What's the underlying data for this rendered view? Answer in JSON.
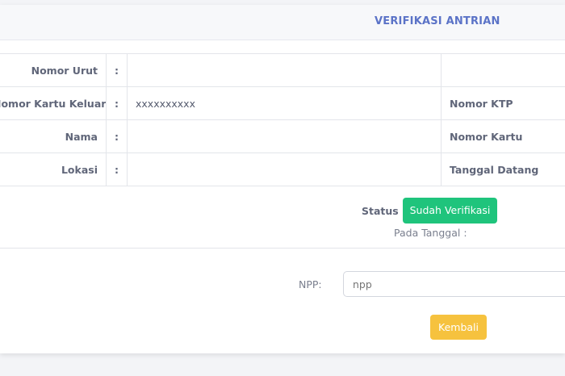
{
  "header": {
    "title": "VERIFIKASI ANTRIAN"
  },
  "info": {
    "rows": [
      {
        "label": "Nomor Urut",
        "colon": ":",
        "value": "",
        "label2": ""
      },
      {
        "label": "Nomor Kartu Keluarga",
        "colon": ":",
        "value": "xxxxxxxxxx",
        "label2": "Nomor KTP"
      },
      {
        "label": "Nama",
        "colon": ":",
        "value": "",
        "label2": "Nomor Kartu"
      },
      {
        "label": "Lokasi",
        "colon": ":",
        "value": "",
        "label2": "Tanggal Datang"
      }
    ]
  },
  "status": {
    "label": "Status :",
    "badge": "Sudah Verifikasi",
    "badge_color": "#1fc47c",
    "date_label": "Pada Tanggal :"
  },
  "form": {
    "npp_label": "NPP:",
    "npp_placeholder": "npp",
    "npp_value": "",
    "back_label": "Kembali",
    "back_color": "#f6c23e"
  }
}
